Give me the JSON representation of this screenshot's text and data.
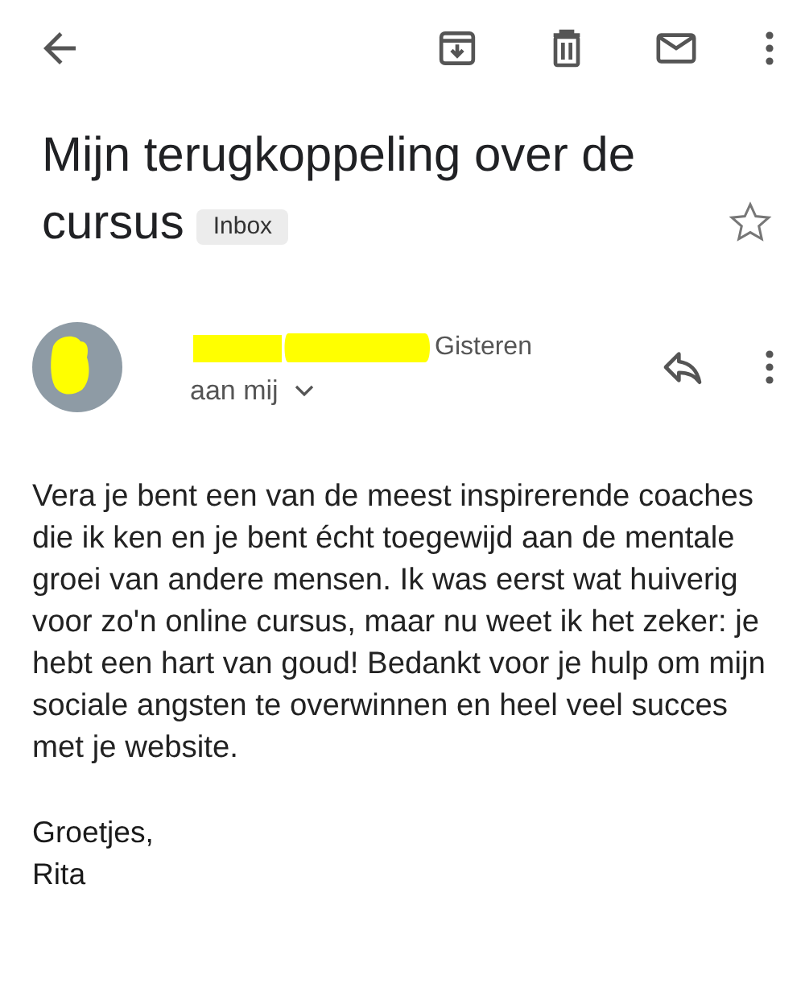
{
  "email": {
    "subject_lines": [
      "Mijn terugkoppeling over de",
      "cursus"
    ],
    "label": "Inbox",
    "starred": false,
    "sender": {
      "date": "Gisteren",
      "recipient": "aan mij"
    },
    "body": "Vera je bent een van de meest inspirerende coaches die ik ken en je bent écht toegewijd aan de mentale groei van andere mensen. Ik was eerst wat huiverig voor zo'n online cursus, maar nu weet ik het zeker: je hebt een hart van goud! Bedankt voor je hulp om mijn sociale angsten te overwinnen en heel veel succes met je website.",
    "closing": "Groetjes,",
    "signature": "Rita"
  }
}
